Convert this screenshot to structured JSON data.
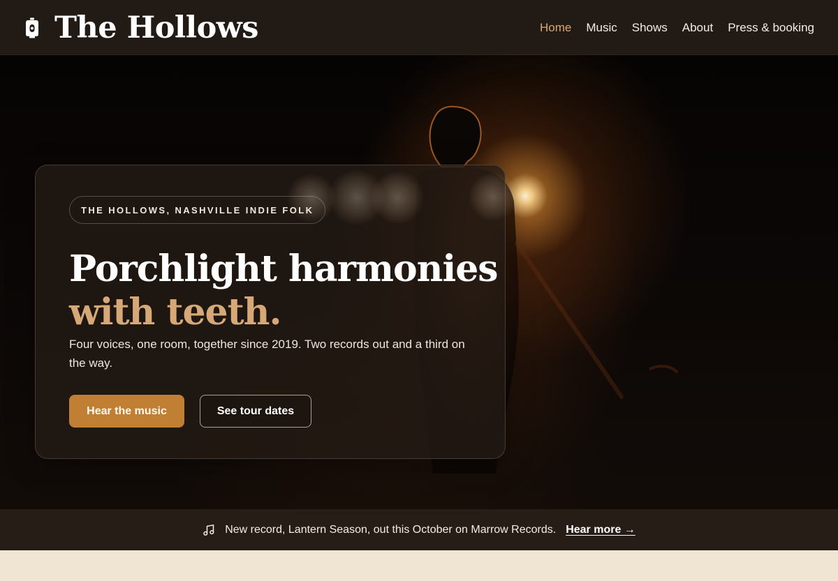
{
  "brand": {
    "name": "The Hollows",
    "icon": "lantern-icon"
  },
  "nav": {
    "items": [
      {
        "label": "Home",
        "active": true
      },
      {
        "label": "Music",
        "active": false
      },
      {
        "label": "Shows",
        "active": false
      },
      {
        "label": "About",
        "active": false
      },
      {
        "label": "Press & booking",
        "active": false
      }
    ]
  },
  "hero": {
    "eyebrow": "THE HOLLOWS, NASHVILLE INDIE FOLK",
    "headline_line1": "Porchlight harmonies",
    "headline_line2": "with teeth.",
    "lede": "Four voices, one room, together since 2019. Two records out and a third on the way.",
    "primary_cta": "Hear the music",
    "secondary_cta": "See tour dates"
  },
  "announcement": {
    "icon": "music-note-icon",
    "text": "New record, Lantern Season, out this October on Marrow Records.",
    "link_label": "Hear more →"
  },
  "colors": {
    "header_bg": "#221a14",
    "accent": "#dca772",
    "headline_accent": "#d6a878",
    "primary_button": "#c17f33",
    "announcement_bg": "#261d16",
    "page_bg": "#f0e4d2"
  }
}
